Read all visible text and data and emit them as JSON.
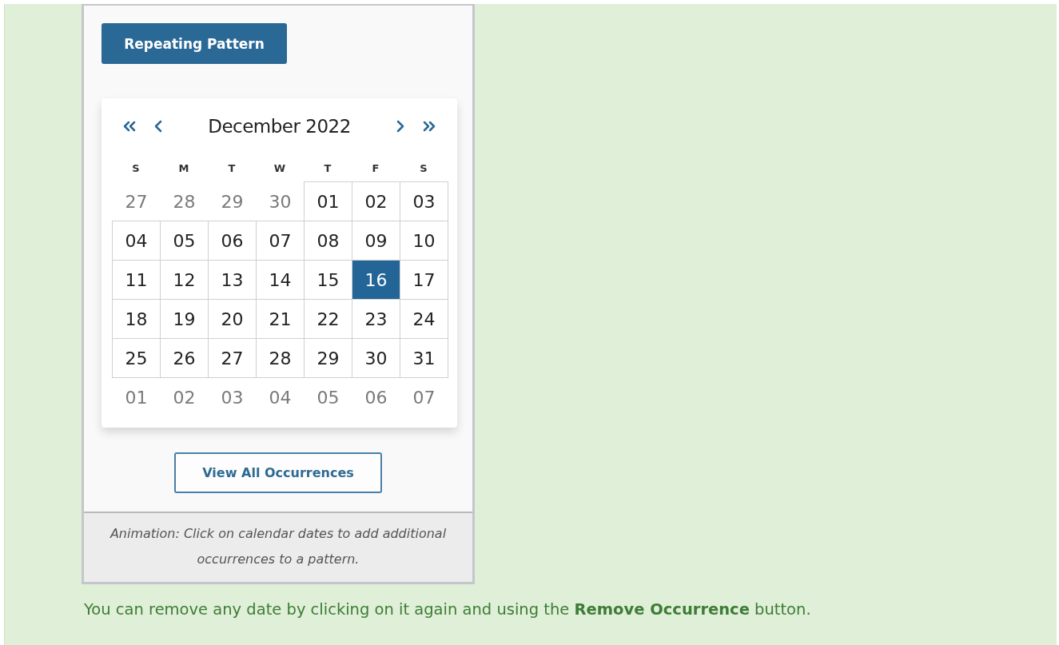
{
  "figure": {
    "pattern_button": "Repeating Pattern",
    "calendar": {
      "month": "December 2022",
      "weekdays": [
        "S",
        "M",
        "T",
        "W",
        "T",
        "F",
        "S"
      ],
      "days": [
        {
          "label": "27",
          "muted": true,
          "selected": false
        },
        {
          "label": "28",
          "muted": true,
          "selected": false
        },
        {
          "label": "29",
          "muted": true,
          "selected": false
        },
        {
          "label": "30",
          "muted": true,
          "selected": false
        },
        {
          "label": "01",
          "muted": false,
          "selected": false
        },
        {
          "label": "02",
          "muted": false,
          "selected": false
        },
        {
          "label": "03",
          "muted": false,
          "selected": false
        },
        {
          "label": "04",
          "muted": false,
          "selected": false
        },
        {
          "label": "05",
          "muted": false,
          "selected": false
        },
        {
          "label": "06",
          "muted": false,
          "selected": false
        },
        {
          "label": "07",
          "muted": false,
          "selected": false
        },
        {
          "label": "08",
          "muted": false,
          "selected": false
        },
        {
          "label": "09",
          "muted": false,
          "selected": false
        },
        {
          "label": "10",
          "muted": false,
          "selected": false
        },
        {
          "label": "11",
          "muted": false,
          "selected": false
        },
        {
          "label": "12",
          "muted": false,
          "selected": false
        },
        {
          "label": "13",
          "muted": false,
          "selected": false
        },
        {
          "label": "14",
          "muted": false,
          "selected": false
        },
        {
          "label": "15",
          "muted": false,
          "selected": false
        },
        {
          "label": "16",
          "muted": false,
          "selected": true
        },
        {
          "label": "17",
          "muted": false,
          "selected": false
        },
        {
          "label": "18",
          "muted": false,
          "selected": false
        },
        {
          "label": "19",
          "muted": false,
          "selected": false
        },
        {
          "label": "20",
          "muted": false,
          "selected": false
        },
        {
          "label": "21",
          "muted": false,
          "selected": false
        },
        {
          "label": "22",
          "muted": false,
          "selected": false
        },
        {
          "label": "23",
          "muted": false,
          "selected": false
        },
        {
          "label": "24",
          "muted": false,
          "selected": false
        },
        {
          "label": "25",
          "muted": false,
          "selected": false
        },
        {
          "label": "26",
          "muted": false,
          "selected": false
        },
        {
          "label": "27",
          "muted": false,
          "selected": false
        },
        {
          "label": "28",
          "muted": false,
          "selected": false
        },
        {
          "label": "29",
          "muted": false,
          "selected": false
        },
        {
          "label": "30",
          "muted": false,
          "selected": false
        },
        {
          "label": "31",
          "muted": false,
          "selected": false
        },
        {
          "label": "01",
          "muted": true,
          "selected": false
        },
        {
          "label": "02",
          "muted": true,
          "selected": false
        },
        {
          "label": "03",
          "muted": true,
          "selected": false
        },
        {
          "label": "04",
          "muted": true,
          "selected": false
        },
        {
          "label": "05",
          "muted": true,
          "selected": false
        },
        {
          "label": "06",
          "muted": true,
          "selected": false
        },
        {
          "label": "07",
          "muted": true,
          "selected": false
        }
      ]
    },
    "occurrences_button": "View All Occurrences",
    "caption": "Animation: Click on calendar dates to add additional occurrences to a pattern."
  },
  "note": "You can remove any date by clicking on it again and using the **Remove Occurrence** button."
}
